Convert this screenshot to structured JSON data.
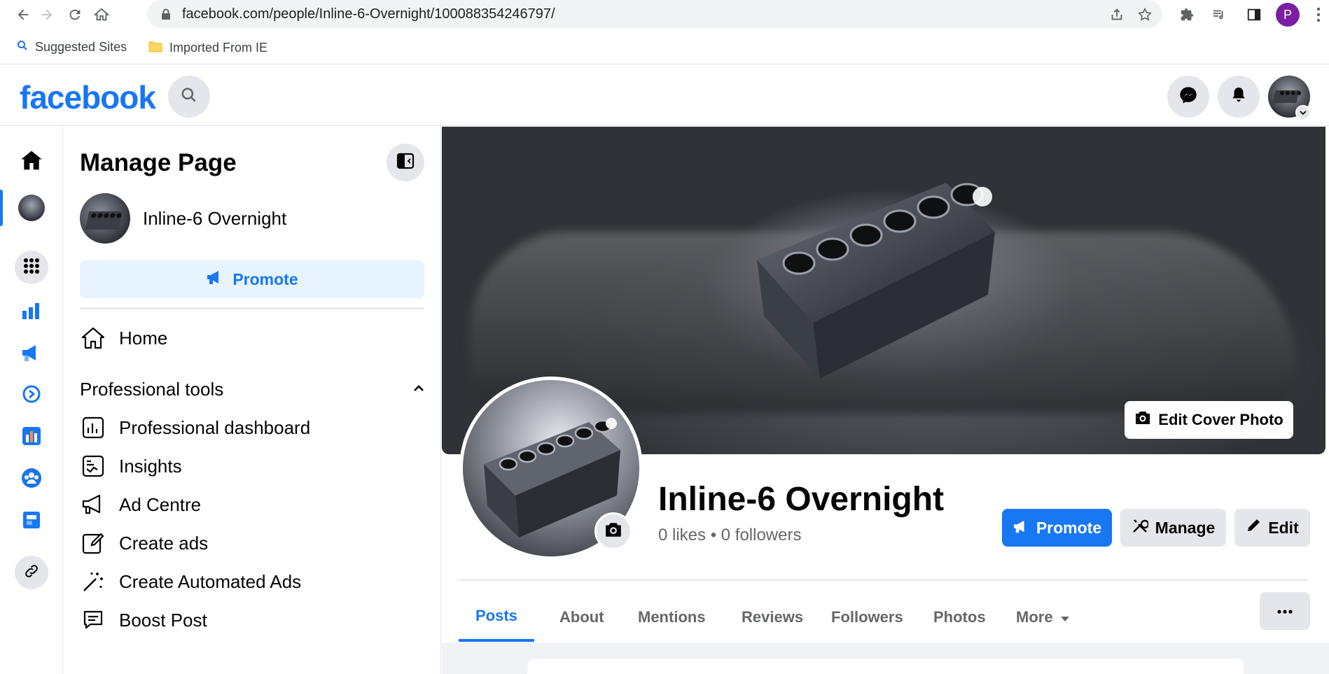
{
  "browser": {
    "url": "facebook.com/people/Inline-6-Overnight/100088354246797/",
    "profile_initial": "P",
    "bookmarks": [
      {
        "label": "Suggested Sites",
        "icon": "search-icon"
      },
      {
        "label": "Imported From IE",
        "icon": "folder-icon"
      }
    ]
  },
  "fb": {
    "logo": "facebook"
  },
  "manage_panel": {
    "title": "Manage Page",
    "page_name": "Inline-6 Overnight",
    "promote_label": "Promote",
    "home_label": "Home",
    "section_label": "Professional tools",
    "tools": [
      {
        "label": "Professional dashboard",
        "icon": "dashboard-icon"
      },
      {
        "label": "Insights",
        "icon": "insights-icon"
      },
      {
        "label": "Ad Centre",
        "icon": "megaphone-icon"
      },
      {
        "label": "Create ads",
        "icon": "pencil-icon"
      },
      {
        "label": "Create Automated Ads",
        "icon": "magic-wand-icon"
      },
      {
        "label": "Boost Post",
        "icon": "chat-bubble-icon"
      }
    ]
  },
  "profile": {
    "edit_cover_label": "Edit Cover Photo",
    "name": "Inline-6 Overnight",
    "stats": "0 likes • 0 followers",
    "promote_label": "Promote",
    "manage_label": "Manage",
    "edit_label": "Edit",
    "tabs": [
      "Posts",
      "About",
      "Mentions",
      "Reviews",
      "Followers",
      "Photos",
      "More"
    ],
    "active_tab": "Posts"
  },
  "colors": {
    "brand": "#1877f2",
    "grey_button": "#e4e6eb",
    "light_blue": "#e7f3ff"
  }
}
